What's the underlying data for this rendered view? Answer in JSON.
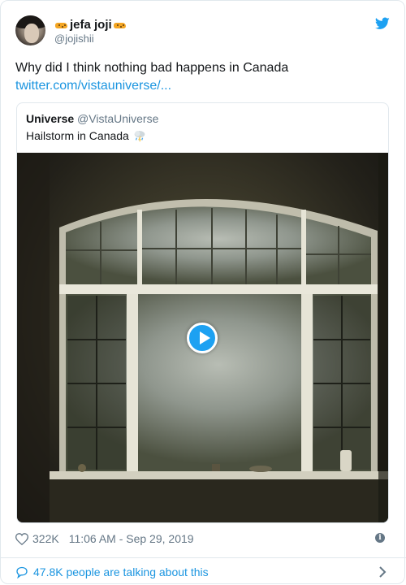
{
  "author": {
    "display_name": "jefa joji",
    "handle": "@jojishii",
    "name_emoji": "leopard-emoji"
  },
  "tweet": {
    "text": "Why did I think nothing bad happens in Canada",
    "link": "twitter.com/vistauniverse/..."
  },
  "quoted_tweet": {
    "name": "Universe",
    "handle": "@VistaUniverse",
    "text": "Hailstorm in Canada",
    "emoji": "cloud-with-rain-emoji"
  },
  "video": {
    "play_icon": "play-icon"
  },
  "meta": {
    "likes": "322K",
    "timestamp": "11:06 AM - Sep 29, 2019"
  },
  "footer": {
    "talking": "47.8K people are talking about this"
  },
  "colors": {
    "accent": "#1da1f2",
    "link": "#1b95e0",
    "muted": "#657786",
    "border": "#e1e8ed"
  }
}
